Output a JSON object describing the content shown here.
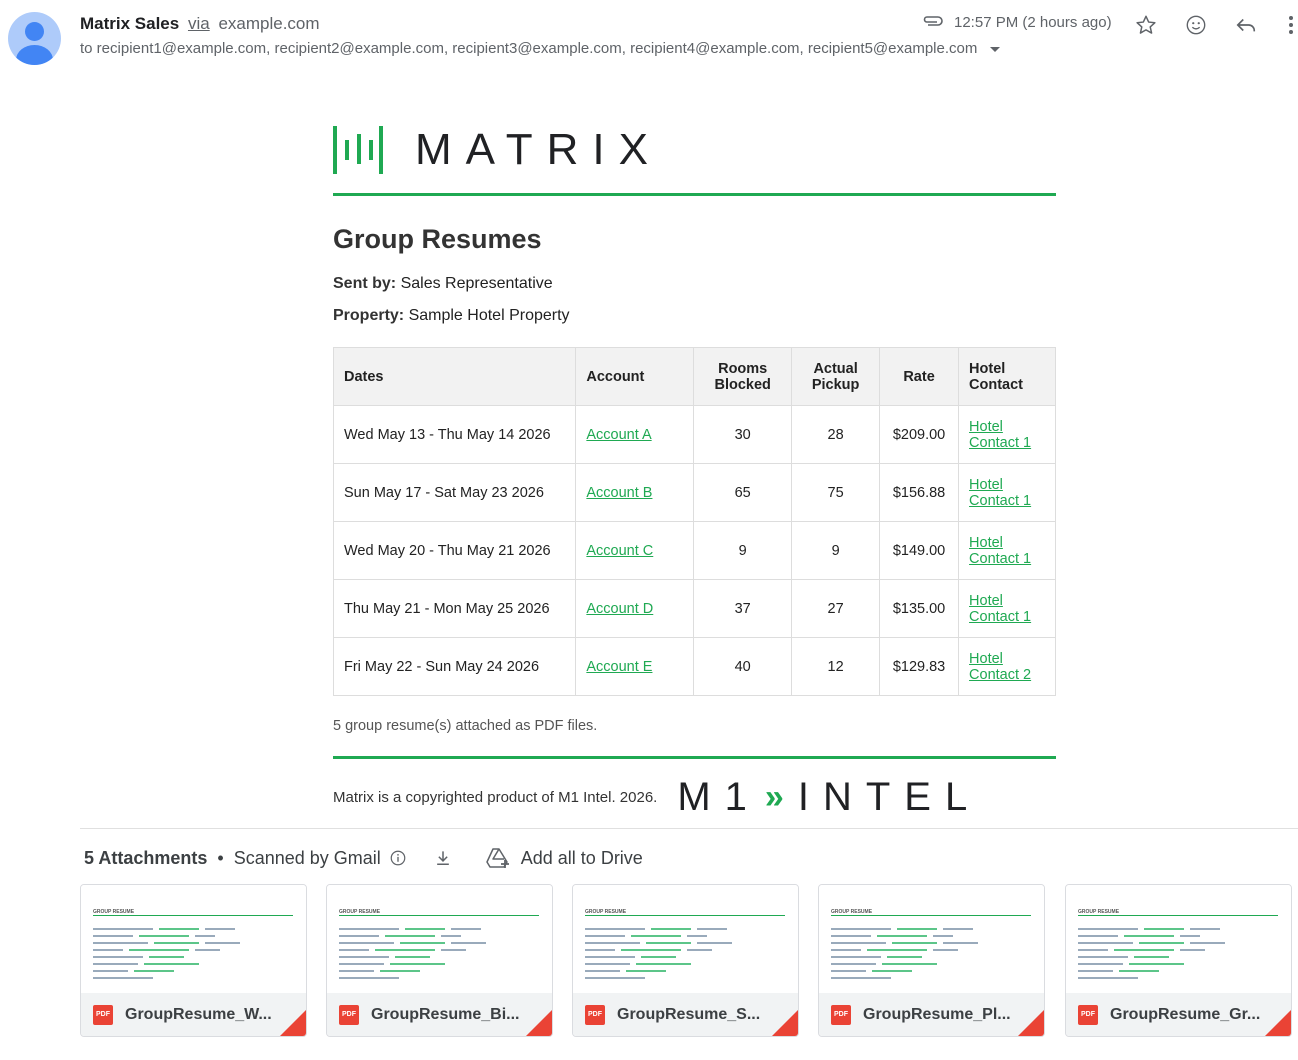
{
  "header": {
    "sender_name": "Matrix Sales",
    "via_label": "via",
    "via_domain": "example.com",
    "recipients": "to recipient1@example.com, recipient2@example.com, recipient3@example.com, recipient4@example.com, recipient5@example.com",
    "time": "12:57 PM (2 hours ago)"
  },
  "email": {
    "logo_text": "MATRIX",
    "title": "Group Resumes",
    "sent_by_label": "Sent by:",
    "sent_by_value": "Sales Representative",
    "property_label": "Property:",
    "property_value": "Sample Hotel Property",
    "columns": {
      "dates": "Dates",
      "account": "Account",
      "rooms_blocked": "Rooms Blocked",
      "actual_pickup": "Actual Pickup",
      "rate": "Rate",
      "hotel_contact": "Hotel Contact"
    },
    "rows": [
      {
        "dates": "Wed May 13 - Thu May 14 2026",
        "account": "Account A",
        "rooms": "30",
        "pickup": "28",
        "rate": "$209.00",
        "contact": "Hotel Contact 1"
      },
      {
        "dates": "Sun May 17 - Sat May 23 2026",
        "account": "Account B",
        "rooms": "65",
        "pickup": "75",
        "rate": "$156.88",
        "contact": "Hotel Contact 1"
      },
      {
        "dates": "Wed May 20 - Thu May 21 2026",
        "account": "Account C",
        "rooms": "9",
        "pickup": "9",
        "rate": "$149.00",
        "contact": "Hotel Contact 1"
      },
      {
        "dates": "Thu May 21 - Mon May 25 2026",
        "account": "Account D",
        "rooms": "37",
        "pickup": "27",
        "rate": "$135.00",
        "contact": "Hotel Contact 1"
      },
      {
        "dates": "Fri May 22 - Sun May 24 2026",
        "account": "Account E",
        "rooms": "40",
        "pickup": "12",
        "rate": "$129.83",
        "contact": "Hotel Contact 2"
      }
    ],
    "note": "5 group resume(s) attached as PDF files.",
    "footer_text": "Matrix is a copyrighted product of M1 Intel. 2026.",
    "footer_logo_left": "M1",
    "footer_logo_right": "INTEL"
  },
  "attachments": {
    "count_label": "5 Attachments",
    "scanned_label": "Scanned by Gmail",
    "add_drive_label": "Add all to Drive",
    "pdf_badge": "PDF",
    "files": [
      {
        "name": "GroupResume_W..."
      },
      {
        "name": "GroupResume_Bi..."
      },
      {
        "name": "GroupResume_S..."
      },
      {
        "name": "GroupResume_Pl..."
      },
      {
        "name": "GroupResume_Gr..."
      }
    ]
  },
  "colors": {
    "accent_green": "#1fa952",
    "avatar_blue": "#4285f4",
    "pdf_red": "#ea4335"
  },
  "icons": [
    "person-icon",
    "paperclip-icon",
    "star-icon",
    "emoji-icon",
    "reply-icon",
    "more-icon",
    "info-icon",
    "download-icon",
    "drive-add-icon",
    "pdf-icon"
  ]
}
